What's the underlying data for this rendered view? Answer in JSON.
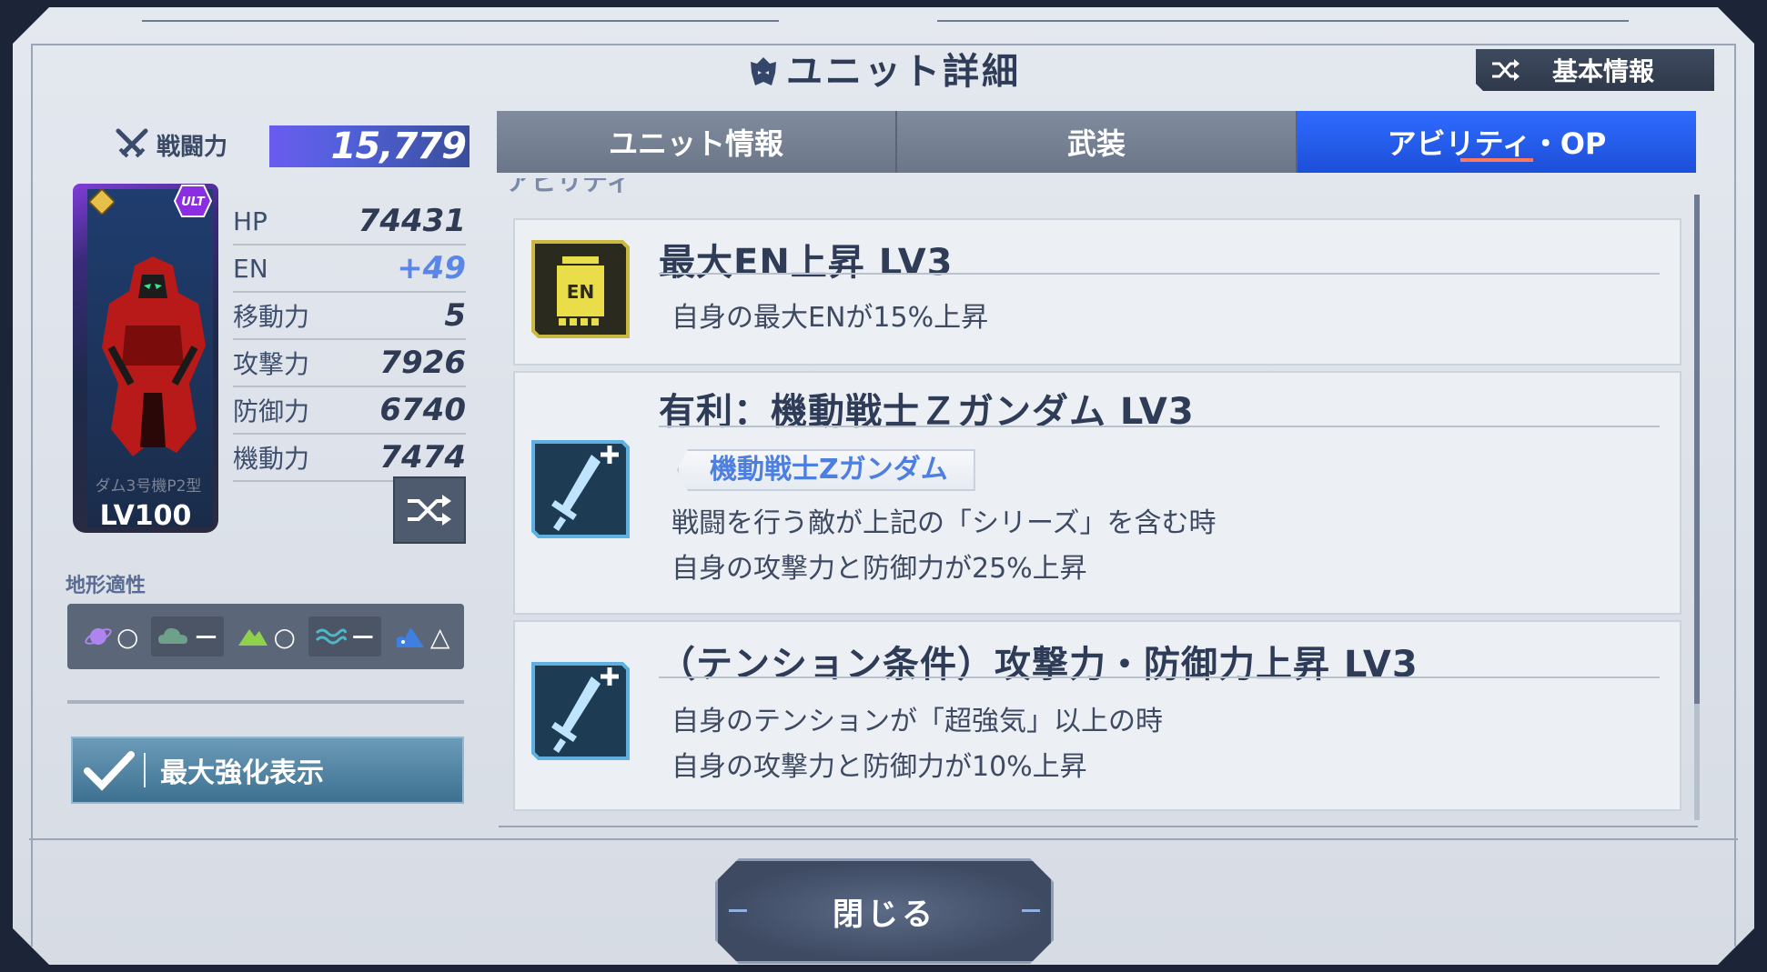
{
  "header": {
    "title": "ユニット詳細",
    "title_icon": "unit-emblem-icon",
    "basic_info_label": "基本情報"
  },
  "unit": {
    "power_label": "戦闘力",
    "power_value": "15,779",
    "card_name": "ダム3号機P2型",
    "level": "LV100",
    "rarity_badge": "ULT",
    "stats": [
      {
        "key": "HP",
        "value": "74431"
      },
      {
        "key": "EN",
        "value": "+49"
      },
      {
        "key": "移動力",
        "value": "5"
      },
      {
        "key": "攻撃力",
        "value": "7926"
      },
      {
        "key": "防御力",
        "value": "6740"
      },
      {
        "key": "機動力",
        "value": "7474"
      }
    ]
  },
  "terrain": {
    "label": "地形適性",
    "cells": [
      {
        "icon": "space-icon",
        "grade": "○"
      },
      {
        "icon": "air-icon",
        "grade": "－"
      },
      {
        "icon": "ground-icon",
        "grade": "○"
      },
      {
        "icon": "water-icon",
        "grade": "－"
      },
      {
        "icon": "underwater-icon",
        "grade": "△"
      }
    ]
  },
  "max_enhance": {
    "label": "最大強化表示",
    "checked": true
  },
  "tabs": [
    {
      "label": "ユニット情報",
      "active": false
    },
    {
      "label": "武装",
      "active": false
    },
    {
      "label": "アビリティ・OP",
      "active": true
    }
  ],
  "section_title": "アビリティ",
  "abilities": [
    {
      "icon": "en-tank-icon",
      "name": "最大EN上昇 LV3",
      "desc": [
        "自身の最大ENが15%上昇"
      ]
    },
    {
      "icon": "sword-plus-icon",
      "name": "有利：機動戦士Ｚガンダム LV3",
      "tag": "機動戦士Zガンダム",
      "desc": [
        "戦闘を行う敵が上記の「シリーズ」を含む時",
        "自身の攻撃力と防御力が25%上昇"
      ]
    },
    {
      "icon": "sword-plus-icon",
      "name": "（テンション条件）攻撃力・防御力上昇 LV3",
      "desc": [
        "自身のテンションが「超強気」以上の時",
        "自身の攻撃力と防御力が10%上昇"
      ]
    }
  ],
  "footer": {
    "close_label": "閉じる"
  },
  "colors": {
    "accent_tab": "#1d4fd8",
    "power_bar": "#6a5cf0",
    "en_value": "#5b86e8",
    "tag_text": "#4c7fe0"
  }
}
